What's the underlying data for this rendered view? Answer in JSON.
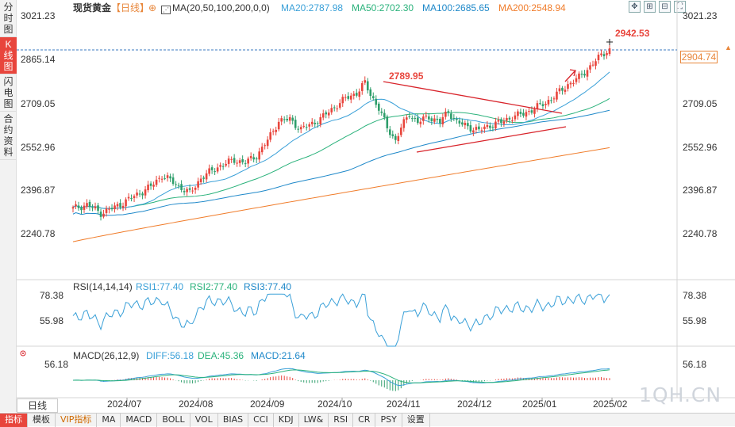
{
  "sidebar": {
    "tabs": [
      {
        "label": "分时图",
        "active": false
      },
      {
        "label": "K线图",
        "active": true
      },
      {
        "label": "闪电图",
        "active": false
      },
      {
        "label": "合约资料",
        "active": false
      }
    ]
  },
  "header": {
    "title": "现货黄金",
    "period": "【日线】",
    "ma_label": "MA(20,50,100,200,0,0)",
    "ma20": "MA20:2787.98",
    "ma50": "MA50:2702.30",
    "ma100": "MA100:2685.65",
    "ma200": "MA200:2548.94"
  },
  "colors": {
    "up": "#e8453c",
    "down": "#2e9e6b",
    "ma20": "#3aa0d8",
    "ma50": "#2ab27b",
    "ma100": "#1e88c9",
    "ma200": "#f07c2a",
    "trend": "#d8232a"
  },
  "price_axis": [
    "3021.23",
    "2865.14",
    "2709.05",
    "2552.96",
    "2396.87",
    "2240.78"
  ],
  "current_price": "2904.74",
  "annotations": {
    "high": "2942.53",
    "peak": "2789.95"
  },
  "rsi": {
    "label": "RSI(14,14,14)",
    "rsi1": "RSI1:77.40",
    "rsi2": "RSI2:77.40",
    "rsi3": "RSI3:77.40",
    "axis": [
      "78.38",
      "55.98"
    ]
  },
  "macd": {
    "label": "MACD(26,12,9)",
    "diff": "DIFF:56.18",
    "dea": "DEA:45.36",
    "macd": "MACD:21.64",
    "axis": [
      "56.18"
    ]
  },
  "x_axis": [
    "2024/07",
    "2024/08",
    "2024/09",
    "2024/10",
    "2024/11",
    "2024/12",
    "2025/01",
    "2025/02"
  ],
  "period_selector": "日线",
  "toolbar": [
    "指标",
    "模板",
    "VIP指标",
    "MA",
    "MACD",
    "BOLL",
    "VOL",
    "BIAS",
    "CCI",
    "KDJ",
    "LW&",
    "RSI",
    "CR",
    "PSY",
    "设置"
  ],
  "watermark": "1QH.CN",
  "chart_data": {
    "type": "candlestick",
    "ylim": [
      2240.78,
      3021.23
    ],
    "anchors_close": [
      [
        0,
        2330
      ],
      [
        5,
        2345
      ],
      [
        10,
        2315
      ],
      [
        15,
        2335
      ],
      [
        22,
        2375
      ],
      [
        28,
        2410
      ],
      [
        32,
        2450
      ],
      [
        36,
        2425
      ],
      [
        42,
        2385
      ],
      [
        46,
        2440
      ],
      [
        52,
        2480
      ],
      [
        58,
        2505
      ],
      [
        62,
        2495
      ],
      [
        66,
        2520
      ],
      [
        70,
        2575
      ],
      [
        74,
        2645
      ],
      [
        78,
        2650
      ],
      [
        82,
        2615
      ],
      [
        86,
        2635
      ],
      [
        90,
        2660
      ],
      [
        94,
        2695
      ],
      [
        98,
        2725
      ],
      [
        102,
        2745
      ],
      [
        105,
        2780
      ],
      [
        107,
        2740
      ],
      [
        110,
        2690
      ],
      [
        113,
        2620
      ],
      [
        116,
        2575
      ],
      [
        118,
        2620
      ],
      [
        121,
        2670
      ],
      [
        124,
        2640
      ],
      [
        128,
        2660
      ],
      [
        132,
        2640
      ],
      [
        135,
        2680
      ],
      [
        138,
        2640
      ],
      [
        142,
        2625
      ],
      [
        146,
        2610
      ],
      [
        150,
        2630
      ],
      [
        154,
        2640
      ],
      [
        158,
        2660
      ],
      [
        162,
        2670
      ],
      [
        166,
        2690
      ],
      [
        170,
        2710
      ],
      [
        174,
        2740
      ],
      [
        178,
        2775
      ],
      [
        182,
        2800
      ],
      [
        186,
        2840
      ],
      [
        190,
        2880
      ],
      [
        193,
        2905
      ]
    ]
  }
}
